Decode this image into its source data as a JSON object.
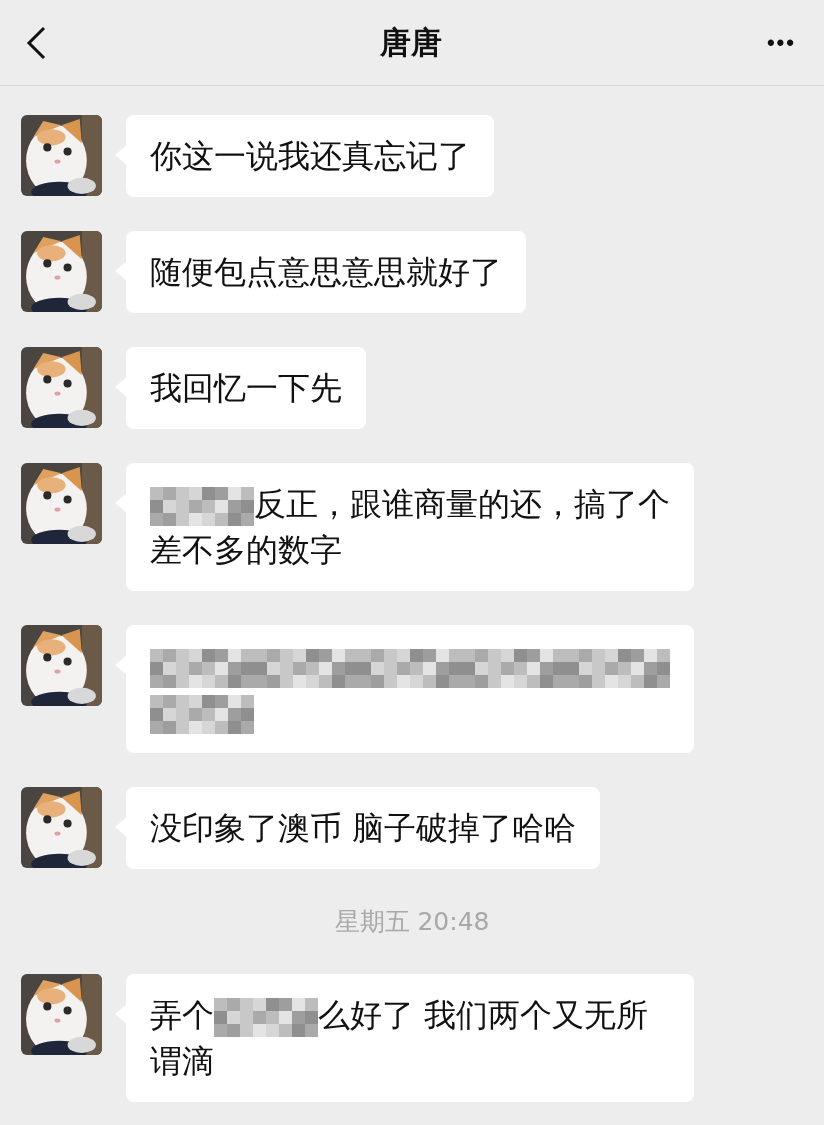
{
  "header": {
    "title": "唐唐",
    "more": "•••"
  },
  "messages": [
    {
      "kind": "message",
      "parts": [
        {
          "kind": "text",
          "text": "你这一说我还真忘记了"
        }
      ]
    },
    {
      "kind": "message",
      "parts": [
        {
          "kind": "text",
          "text": "随便包点意思意思就好了"
        }
      ]
    },
    {
      "kind": "message",
      "parts": [
        {
          "kind": "text",
          "text": "我回忆一下先"
        }
      ]
    },
    {
      "kind": "message",
      "parts": [
        {
          "kind": "redacted"
        },
        {
          "kind": "text",
          "text": "反正，跟谁商量的还，搞了个差不多的数字"
        }
      ]
    },
    {
      "kind": "message",
      "parts": [
        {
          "kind": "redacted"
        },
        {
          "kind": "redacted"
        },
        {
          "kind": "redacted"
        },
        {
          "kind": "redacted"
        },
        {
          "kind": "redacted"
        },
        {
          "kind": "redacted"
        }
      ]
    },
    {
      "kind": "message",
      "parts": [
        {
          "kind": "text",
          "text": "没印象了澳币 脑子破掉了哈哈"
        }
      ]
    },
    {
      "kind": "time",
      "text": "星期五 20:48"
    },
    {
      "kind": "message",
      "parts": [
        {
          "kind": "text",
          "text": "弄个"
        },
        {
          "kind": "redacted"
        },
        {
          "kind": "text",
          "text": "么好了 我们两个又无所谓滴"
        }
      ]
    }
  ]
}
